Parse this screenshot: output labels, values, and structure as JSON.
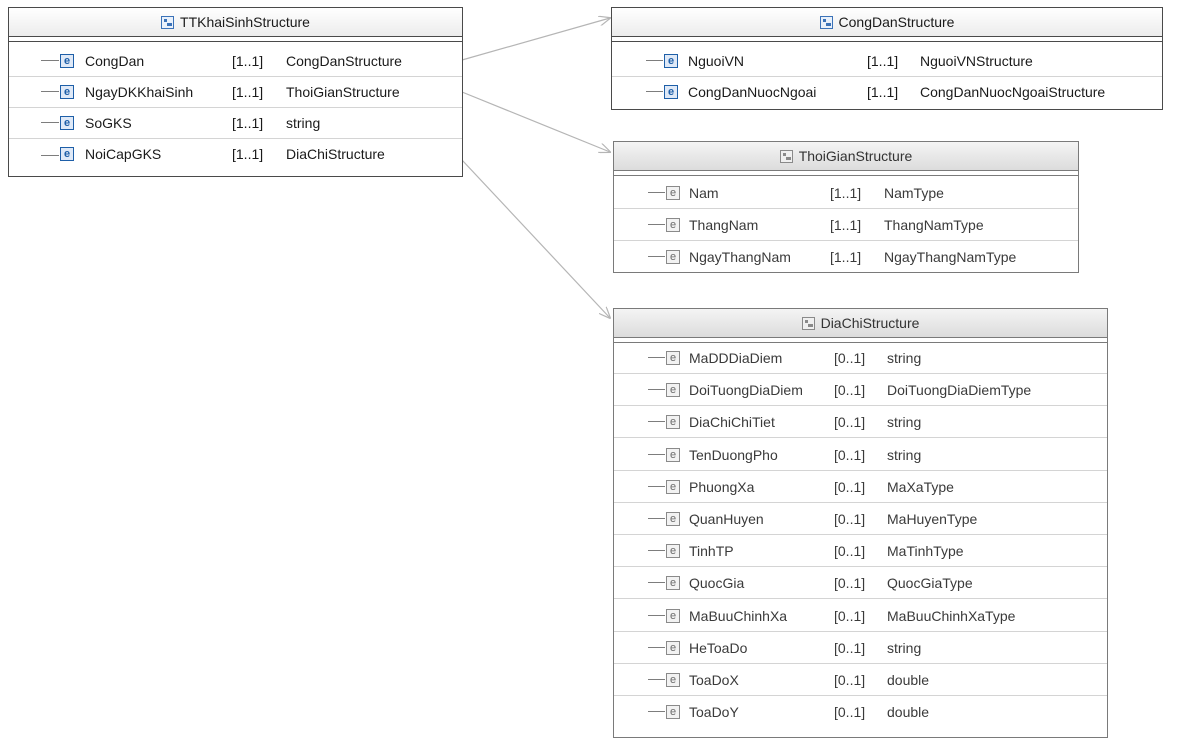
{
  "connector_color": "#b5b5b5",
  "accent_color": "#1e5fa8",
  "boxes": {
    "main": {
      "title": "TTKhaiSinhStructure",
      "compositor": "sequence",
      "elements": [
        {
          "name": "CongDan",
          "card": "[1..1]",
          "type": "CongDanStructure"
        },
        {
          "name": "NgayDKKhaiSinh",
          "card": "[1..1]",
          "type": "ThoiGianStructure"
        },
        {
          "name": "SoGKS",
          "card": "[1..1]",
          "type": "string"
        },
        {
          "name": "NoiCapGKS",
          "card": "[1..1]",
          "type": "DiaChiStructure"
        }
      ]
    },
    "congdan": {
      "title": "CongDanStructure",
      "compositor": "choice",
      "elements": [
        {
          "name": "NguoiVN",
          "card": "[1..1]",
          "type": "NguoiVNStructure"
        },
        {
          "name": "CongDanNuocNgoai",
          "card": "[1..1]",
          "type": "CongDanNuocNgoaiStructure"
        }
      ]
    },
    "thoigian": {
      "title": "ThoiGianStructure",
      "compositor": "choice",
      "elements": [
        {
          "name": "Nam",
          "card": "[1..1]",
          "type": "NamType"
        },
        {
          "name": "ThangNam",
          "card": "[1..1]",
          "type": "ThangNamType"
        },
        {
          "name": "NgayThangNam",
          "card": "[1..1]",
          "type": "NgayThangNamType"
        }
      ]
    },
    "diachi": {
      "title": "DiaChiStructure",
      "compositor": "sequence",
      "elements": [
        {
          "name": "MaDDDiaDiem",
          "card": "[0..1]",
          "type": "string"
        },
        {
          "name": "DoiTuongDiaDiem",
          "card": "[0..1]",
          "type": "DoiTuongDiaDiemType"
        },
        {
          "name": "DiaChiChiTiet",
          "card": "[0..1]",
          "type": "string"
        },
        {
          "name": "TenDuongPho",
          "card": "[0..1]",
          "type": "string"
        },
        {
          "name": "PhuongXa",
          "card": "[0..1]",
          "type": "MaXaType"
        },
        {
          "name": "QuanHuyen",
          "card": "[0..1]",
          "type": "MaHuyenType"
        },
        {
          "name": "TinhTP",
          "card": "[0..1]",
          "type": "MaTinhType"
        },
        {
          "name": "QuocGia",
          "card": "[0..1]",
          "type": "QuocGiaType"
        },
        {
          "name": "MaBuuChinhXa",
          "card": "[0..1]",
          "type": "MaBuuChinhXaType"
        },
        {
          "name": "HeToaDo",
          "card": "[0..1]",
          "type": "string"
        },
        {
          "name": "ToaDoX",
          "card": "[0..1]",
          "type": "double"
        },
        {
          "name": "ToaDoY",
          "card": "[0..1]",
          "type": "double"
        }
      ]
    }
  }
}
